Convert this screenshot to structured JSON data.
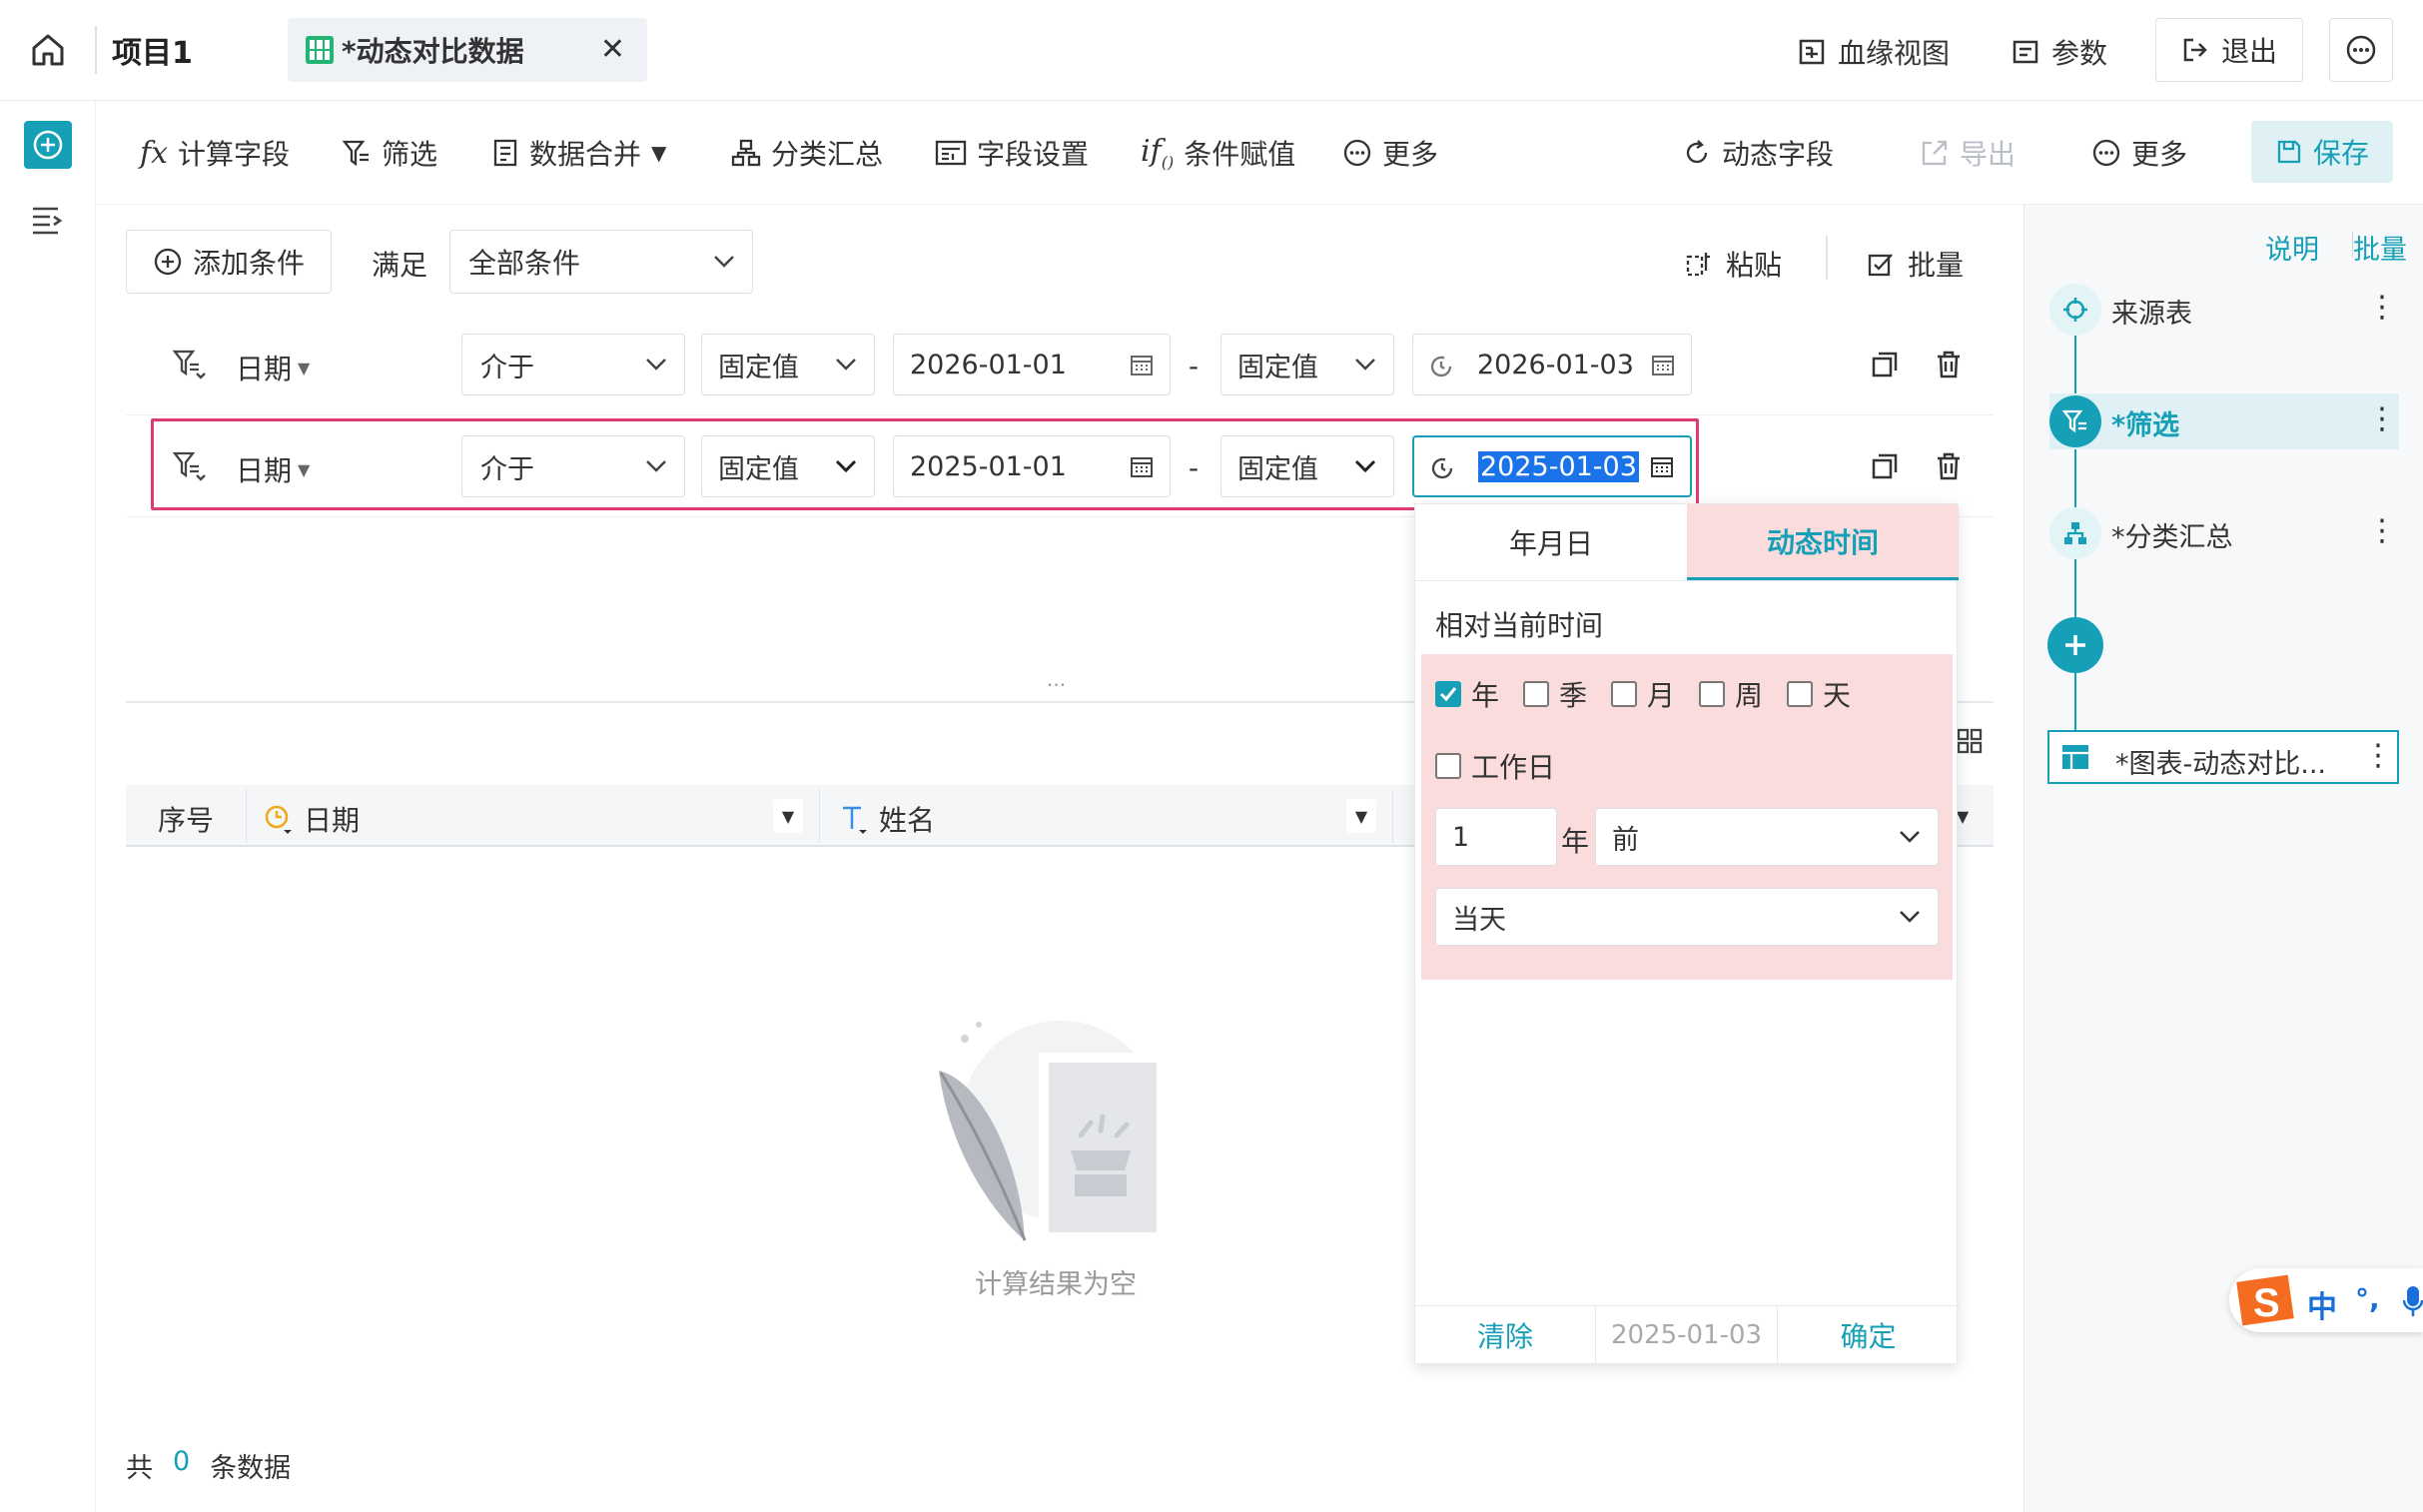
{
  "topbar": {
    "project_name": "项目1",
    "tab_label": "*动态对比数据",
    "lineage_label": "血缘视图",
    "params_label": "参数",
    "exit_label": "退出"
  },
  "toolbar": {
    "calc_field": "计算字段",
    "filter": "筛选",
    "merge": "数据合并",
    "group_summary": "分类汇总",
    "field_settings": "字段设置",
    "cond_assign": "条件赋值",
    "more_left": "更多",
    "dynamic_field": "动态字段",
    "export": "导出",
    "more_right": "更多",
    "save": "保存"
  },
  "filter": {
    "add_condition": "添加条件",
    "satisfy_label": "满足",
    "satisfy_value": "全部条件",
    "paste": "粘贴",
    "batch": "批量",
    "rows": [
      {
        "field": "日期",
        "op": "介于",
        "type1": "固定值",
        "date1": "2026-01-01",
        "sep": "-",
        "type2": "固定值",
        "date2": "2026-01-03"
      },
      {
        "field": "日期",
        "op": "介于",
        "type1": "固定值",
        "date1": "2025-01-01",
        "sep": "-",
        "type2": "固定值",
        "date2": "2025-01-03"
      }
    ],
    "divider_handle": "..."
  },
  "table": {
    "headers": [
      "序号",
      "日期",
      "姓名"
    ],
    "empty_text": "计算结果为空",
    "footer_prefix": "共",
    "footer_count": "0",
    "footer_suffix": "条数据"
  },
  "datepicker": {
    "tab_ymd": "年月日",
    "tab_dynamic": "动态时间",
    "relative_label": "相对当前时间",
    "units": [
      {
        "label": "年",
        "checked": true
      },
      {
        "label": "季",
        "checked": false
      },
      {
        "label": "月",
        "checked": false
      },
      {
        "label": "周",
        "checked": false
      },
      {
        "label": "天",
        "checked": false
      }
    ],
    "workday_label": "工作日",
    "offset_value": "1",
    "offset_unit": "年",
    "direction": "前",
    "anchor": "当天",
    "clear": "清除",
    "preview": "2025-01-03",
    "confirm": "确定"
  },
  "rightpanel": {
    "explain": "说明",
    "batch": "批量",
    "nodes": [
      "来源表",
      "*筛选",
      "*分类汇总",
      "*图表-动态对比..."
    ]
  },
  "ime": {
    "lang": "中",
    "punct": "°,"
  },
  "colors": {
    "accent": "#16a0b7",
    "highlight_border": "#e03c74",
    "pink_region": "#fadcdc"
  }
}
